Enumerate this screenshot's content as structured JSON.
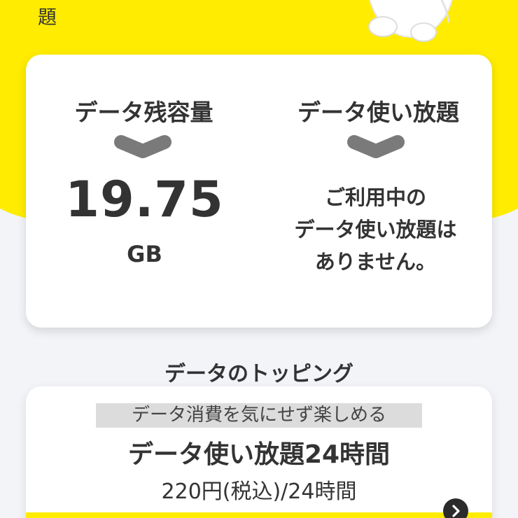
{
  "header": {
    "partial_text": "題"
  },
  "balance": {
    "remaining_title": "データ残容量",
    "remaining_value": "19.75",
    "remaining_unit": "GB",
    "unlimited_title": "データ使い放題",
    "unlimited_message_lines": [
      "ご利用中の",
      "データ使い放題は",
      "ありません。"
    ]
  },
  "toppings": {
    "section_title": "データのトッピング",
    "card": {
      "tag": "データ消費を気にせず楽しめる",
      "name": "データ使い放題24時間",
      "price": "220円(税込)/24時間"
    }
  },
  "icons": {
    "expand_left": "chevron-down-icon",
    "expand_right": "chevron-down-icon",
    "detail_arrow": "chevron-right-icon",
    "mascot": "mascot-character"
  },
  "colors": {
    "brand_yellow": "#ffec00",
    "chevron_gray": "#7a7a7a",
    "text_dark": "#333333",
    "tag_gray": "#dcdcdc",
    "background": "#f2f4f8"
  }
}
